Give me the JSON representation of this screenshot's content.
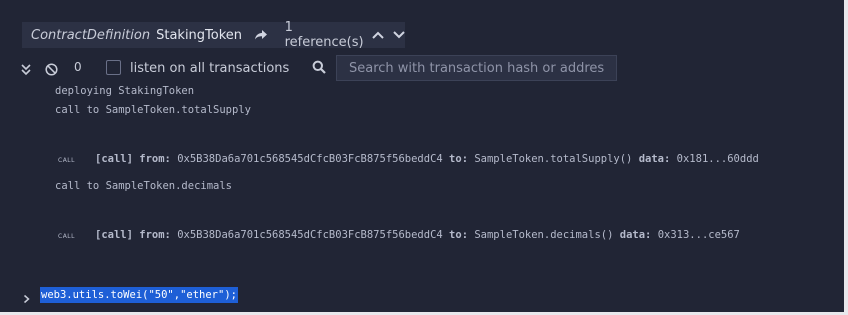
{
  "header": {
    "type_label": "ContractDefinition",
    "name": "StakingToken",
    "references": "1 reference(s)"
  },
  "toolbar": {
    "count": "0",
    "listen_label": "listen on all transactions",
    "search_placeholder": "Search with transaction hash or address"
  },
  "log": {
    "line1": "deploying StakingToken",
    "line2": "call to SampleToken.totalSupply",
    "call1": {
      "badge": "CALL",
      "tag": "[call]",
      "from_label": "from:",
      "from": "0x5B38Da6a701c568545dCfcB03FcB875f56beddC4",
      "to_label": "to:",
      "to": "SampleToken.totalSupply()",
      "data_label": "data:",
      "data": "0x181...60ddd"
    },
    "line3": "call to SampleToken.decimals",
    "call2": {
      "badge": "CALL",
      "tag": "[call]",
      "from_label": "from:",
      "from": "0x5B38Da6a701c568545dCfcB03FcB875f56beddC4",
      "to_label": "to:",
      "to": "SampleToken.decimals()",
      "data_label": "data:",
      "data": "0x313...ce567"
    }
  },
  "prompt": {
    "command": "web3.utils.toWei(\"50\",\"ether\");"
  }
}
